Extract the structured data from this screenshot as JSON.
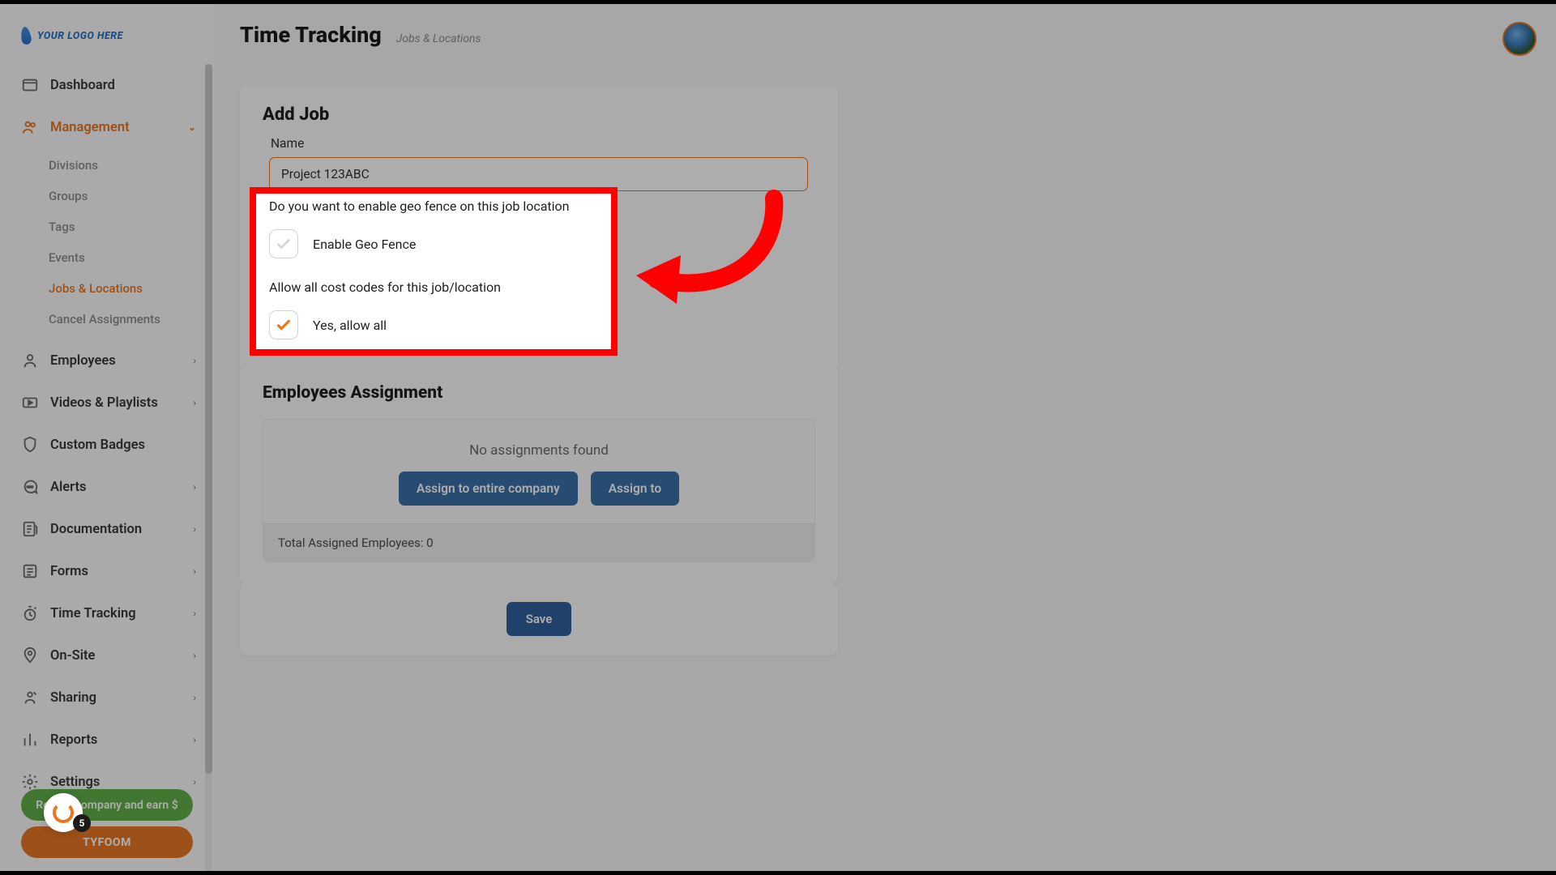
{
  "logo": "YOUR LOGO HERE",
  "page_title": "Time Tracking",
  "breadcrumb": "Jobs & Locations",
  "nav": {
    "dashboard": "Dashboard",
    "management": "Management",
    "employees": "Employees",
    "videos": "Videos & Playlists",
    "badges": "Custom Badges",
    "alerts": "Alerts",
    "documentation": "Documentation",
    "forms": "Forms",
    "time_tracking": "Time Tracking",
    "onsite": "On-Site",
    "sharing": "Sharing",
    "reports": "Reports",
    "settings": "Settings"
  },
  "subnav": {
    "divisions": "Divisions",
    "groups": "Groups",
    "tags": "Tags",
    "events": "Events",
    "jobs": "Jobs & Locations",
    "cancel": "Cancel Assignments"
  },
  "promo1": "Refer a company and earn $",
  "promo2": "TYFOOM",
  "float_badge": "5",
  "add_job": {
    "heading": "Add Job",
    "name_label": "Name",
    "name_value": "Project 123ABC",
    "geo_q": "Do you want to enable geo fence on this job location",
    "geo_label": "Enable Geo Fence",
    "cost_q": "Allow all cost codes for this job/location",
    "cost_label": "Yes, allow all"
  },
  "assign": {
    "heading": "Employees Assignment",
    "none": "No assignments found",
    "btn_company": "Assign to entire company",
    "btn_to": "Assign to",
    "total": "Total Assigned Employees: 0"
  },
  "save": "Save"
}
